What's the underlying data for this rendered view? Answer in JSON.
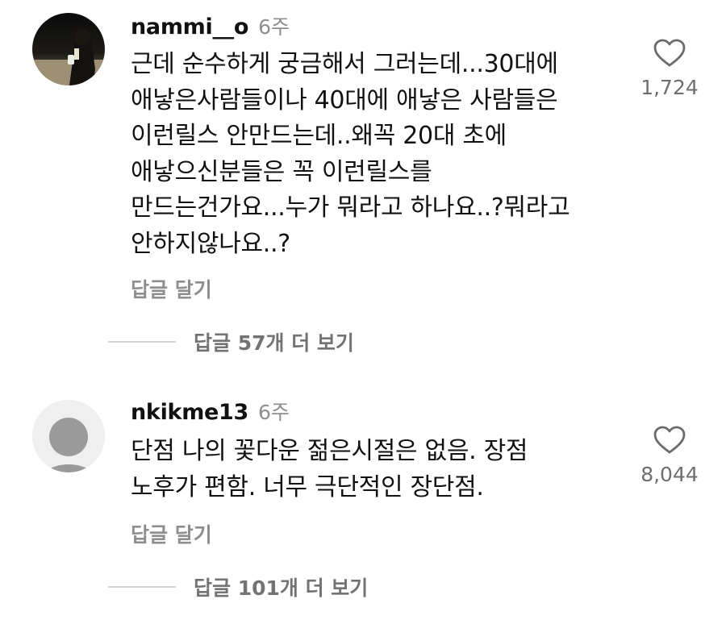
{
  "comments": [
    {
      "username": "nammi__o",
      "time": "6주",
      "lines": [
        "근데 순수하게 궁금해서 그러는데...30대에",
        "애낳은사람들이나 40대에 애낳은 사람들은",
        "이런릴스 안만드는데..왜꼭 20대 초에",
        "애낳으신분들은 꼭 이런릴스를",
        "만드는건가요...누가 뭐라고 하나요..?뭐라고",
        "안하지않나요..?"
      ],
      "reply_label": "답글 달기",
      "like_count": "1,724",
      "view_replies": "답글 57개 더 보기"
    },
    {
      "username": "nkikme13",
      "time": "6주",
      "lines": [
        "단점 나의 꽃다운 젊은시절은 없음. 장점",
        "노후가 편함. 너무 극단적인 장단점."
      ],
      "reply_label": "답글 달기",
      "like_count": "8,044",
      "view_replies": "답글 101개 더 보기"
    }
  ],
  "icons": {
    "like": "heart-outline-icon",
    "avatar_default": "default-avatar-icon"
  },
  "colors": {
    "muted_text": "#8e8e8e",
    "body_text": "#111111",
    "divider": "#d4d4d4"
  }
}
